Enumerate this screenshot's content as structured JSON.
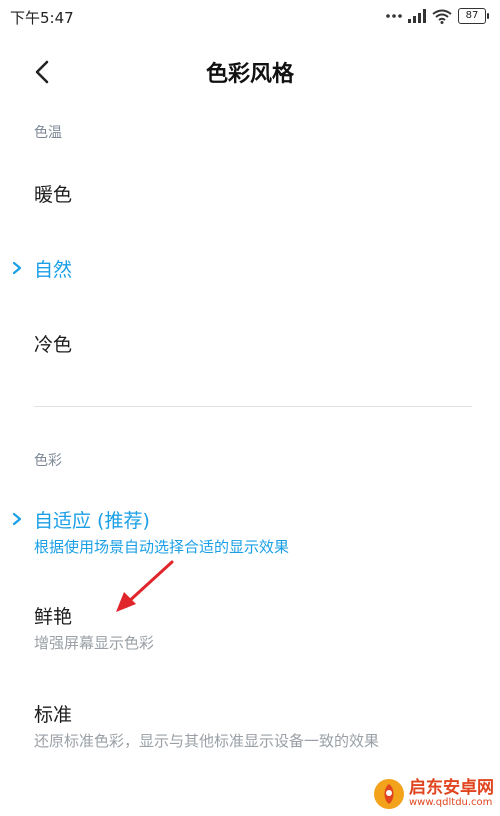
{
  "status_bar": {
    "time": "下午5:47",
    "battery": "87",
    "icons": [
      "dots-icon",
      "signal-icon",
      "wifi-icon",
      "battery-icon"
    ]
  },
  "header": {
    "title": "色彩风格",
    "back_icon": "back-chevron-icon"
  },
  "color_temperature": {
    "label": "色温",
    "options": [
      {
        "title": "暖色",
        "selected": false
      },
      {
        "title": "自然",
        "selected": true
      },
      {
        "title": "冷色",
        "selected": false
      }
    ]
  },
  "color": {
    "label": "色彩",
    "options": [
      {
        "title": "自适应 (推荐)",
        "desc": "根据使用场景自动选择合适的显示效果",
        "selected": true
      },
      {
        "title": "鲜艳",
        "desc": "增强屏幕显示色彩",
        "selected": false
      },
      {
        "title": "标准",
        "desc": "还原标准色彩，显示与其他标准显示设备一致的效果",
        "selected": false
      }
    ]
  },
  "watermark": {
    "title": "启东安卓网",
    "url": "www.qdltdu.com"
  },
  "colors": {
    "accent": "#1a9fe6",
    "section_label": "#7f8a99",
    "annotation_arrow": "#e0252b"
  }
}
